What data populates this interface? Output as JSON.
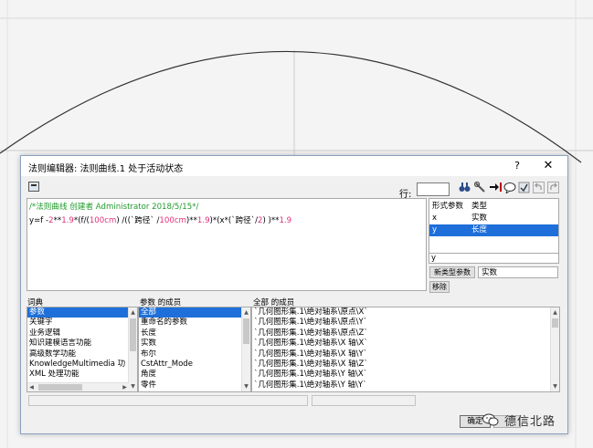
{
  "dialog": {
    "title": "法则编辑器: 法则曲线.1 处于活动状态",
    "help": "?",
    "close": "✕"
  },
  "toolbar": {
    "row_label": "行:",
    "row_value": ""
  },
  "editor": {
    "line1": "/*法则曲线 创建者 Administrator 2018/5/15*/",
    "line2": {
      "a": "y=f -",
      "b": "2",
      "c": "**",
      "d": "1.9",
      "e": "*(f/(",
      "f": "100cm",
      "g": ") /((`跨径` /",
      "h": "100cm",
      "i": ")**",
      "j": "1.9",
      "k": ")*(x*(`跨径`/",
      "l": "2",
      "m": ") )**",
      "n": "1.9"
    }
  },
  "param_table": {
    "headers": [
      "形式参数",
      "类型"
    ],
    "rows": [
      {
        "name": "x",
        "type": "实数"
      },
      {
        "name": "y",
        "type": "长度"
      }
    ],
    "name_input": "y",
    "new_type_button": "新类型参数",
    "type_select": "实数",
    "remove_button": "移除"
  },
  "lists": {
    "dict_title": "词典",
    "dict_items": [
      "参数",
      "关键字",
      "业务逻辑",
      "知识建模语言功能",
      "高级数学功能",
      "KnowledgeMultimedia 功",
      "XML 处理功能"
    ],
    "members_title": "参数 的成员",
    "members_items": [
      "全部",
      "重命名的参数",
      "长度",
      "实数",
      "布尔",
      "CstAttr_Mode",
      "角度",
      "零件"
    ],
    "all_title": "全部 的成员",
    "all_items": [
      "`几何图形集.1\\绝对轴系\\原点\\X`",
      "`几何图形集.1\\绝对轴系\\原点\\Y`",
      "`几何图形集.1\\绝对轴系\\原点\\Z`",
      "`几何图形集.1\\绝对轴系\\X 轴\\X`",
      "`几何图形集.1\\绝对轴系\\X 轴\\Y`",
      "`几何图形集.1\\绝对轴系\\X 轴\\Z`",
      "`几何图形集.1\\绝对轴系\\Y 轴\\X`",
      "`几何图形集.1\\绝对轴系\\Y 轴\\Y`"
    ]
  },
  "buttons": {
    "ok": "确定"
  },
  "watermark": {
    "text": "德信北路"
  },
  "colors": {
    "comment": "#1f9a2a",
    "number": "#e0307a",
    "selection": "#1e6fd9"
  }
}
